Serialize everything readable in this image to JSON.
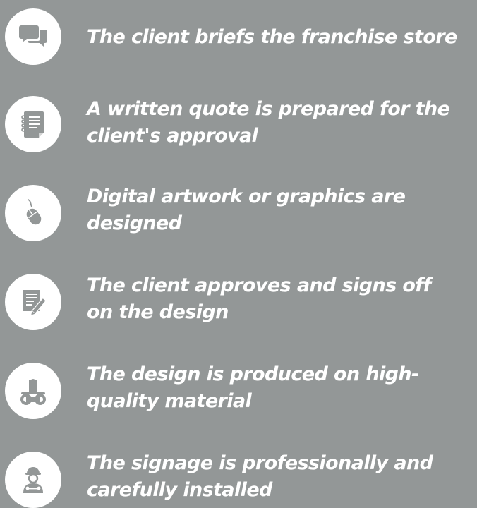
{
  "colors": {
    "background": "#939797",
    "icon_circle": "#ffffff",
    "icon_glyph": "#939797",
    "text": "#ffffff"
  },
  "steps": [
    {
      "icon": "chat-bubbles-icon",
      "lines": [
        "The client briefs the franchise store"
      ]
    },
    {
      "icon": "notepad-icon",
      "lines": [
        "A written quote is prepared for the",
        "client's approval"
      ]
    },
    {
      "icon": "computer-mouse-icon",
      "lines": [
        "Digital artwork or graphics are",
        "designed"
      ]
    },
    {
      "icon": "document-pencil-icon",
      "lines": [
        "The client approves and signs off",
        "on the design"
      ]
    },
    {
      "icon": "material-rolls-icon",
      "lines": [
        "The design is produced on high-",
        "quality material"
      ]
    },
    {
      "icon": "installer-worker-icon",
      "lines": [
        "The signage is professionally and",
        "carefully installed"
      ]
    }
  ]
}
